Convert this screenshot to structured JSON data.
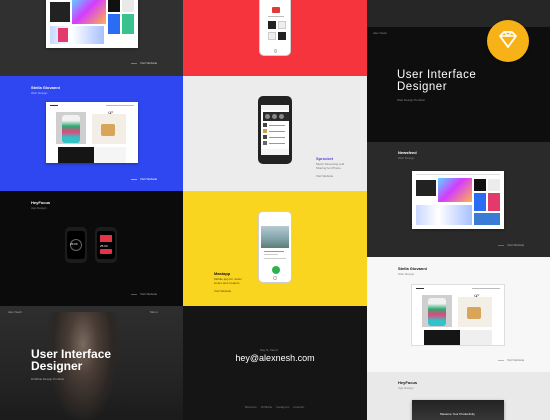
{
  "tiles": {
    "t1": {
      "caption": "Visit Website"
    },
    "t2": {
      "title": "Stella Giovanni",
      "sub": "Web Design",
      "caption": "Visit Website"
    },
    "t3": {
      "title": "HeyFocus",
      "sub": "App Design",
      "caption": "Visit Website"
    },
    "t4": {
      "brand": "Alex Nesh",
      "title": "User Interface Designer",
      "sub": "Dribbble Design Portfolio",
      "caption": "Menu"
    },
    "t6": {
      "app": "Sprocket",
      "sub_lines": [
        "Music Streaming and",
        "Sharing for iPhone"
      ],
      "caption": "Visit Website"
    },
    "t7": {
      "title": "Mastapp",
      "sub_lines": [
        "Mobile app for music",
        "lovers and creators"
      ],
      "caption": "Visit Website"
    },
    "t8": {
      "kicker": "Say hi, friend",
      "email": "hey@alexnesh.com",
      "links": [
        "Behance",
        "Dribbble",
        "Instagram",
        "LinkedIn"
      ]
    },
    "t9": {
      "brand": "Alex Nesh",
      "title": "User Interface Designer",
      "sub": "Web Design Portfolio"
    },
    "t10": {
      "title": "Newsfeed",
      "sub": "Web Design",
      "caption": "Visit Website"
    },
    "t11": {
      "title": "Stella Giovanni",
      "sub": "Web Design",
      "caption": "Visit Website"
    },
    "t12": {
      "title": "HeyFocus",
      "sub": "App Design",
      "preview_text": "Measure Your Productivity"
    }
  },
  "watch": {
    "left_time": "25:00",
    "right_time": "25:00"
  },
  "badge": {
    "icon": "sketch-diamond-icon",
    "color": "#f7b217"
  },
  "colors": {
    "blue": "#2f47f0",
    "red": "#f6343e",
    "yellow": "#f9d520",
    "dark": "#151515"
  }
}
